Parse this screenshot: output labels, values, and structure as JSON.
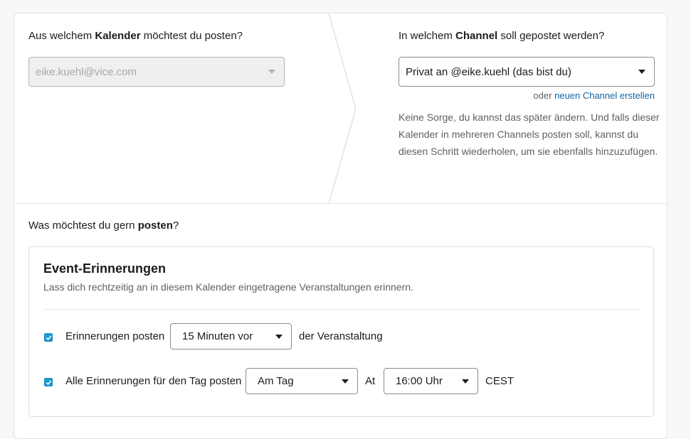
{
  "calendar": {
    "question_pre": "Aus welchem ",
    "question_bold": "Kalender",
    "question_post": " möchtest du posten?",
    "select_value": "eike.kuehl@vice.com"
  },
  "channel": {
    "question_pre": "In welchem ",
    "question_bold": "Channel",
    "question_post": " soll gepostet werden?",
    "select_value": "Privat an @eike.kuehl (das bist du)",
    "or_text": "oder ",
    "create_link": "neuen Channel erstellen",
    "help_text": "Keine Sorge, du kannst das später ändern. Und falls dieser Kalender in mehreren Channels posten soll, kannst du diesen Schritt wiederholen, um sie ebenfalls hinzuzufügen."
  },
  "post": {
    "question_pre": "Was möchtest du gern ",
    "question_bold": "posten",
    "question_post": "?"
  },
  "event_reminders": {
    "title": "Event-Erinnerungen",
    "subtitle": "Lass dich rechtzeitig an in diesem Kalender eingetragene Veranstaltungen erinnern.",
    "row1": {
      "checked": true,
      "label": "Erinnerungen posten",
      "select_value": "15 Minuten vor",
      "suffix": "der Veranstaltung"
    },
    "row2": {
      "checked": true,
      "label": "Alle Erinnerungen für den Tag posten",
      "day_select_value": "Am Tag",
      "at_label": "At",
      "time_select_value": "16:00 Uhr",
      "timezone": "CEST"
    }
  },
  "colors": {
    "link": "#1264a3",
    "checkbox": "#1d9bd1",
    "muted_text": "#616061"
  }
}
